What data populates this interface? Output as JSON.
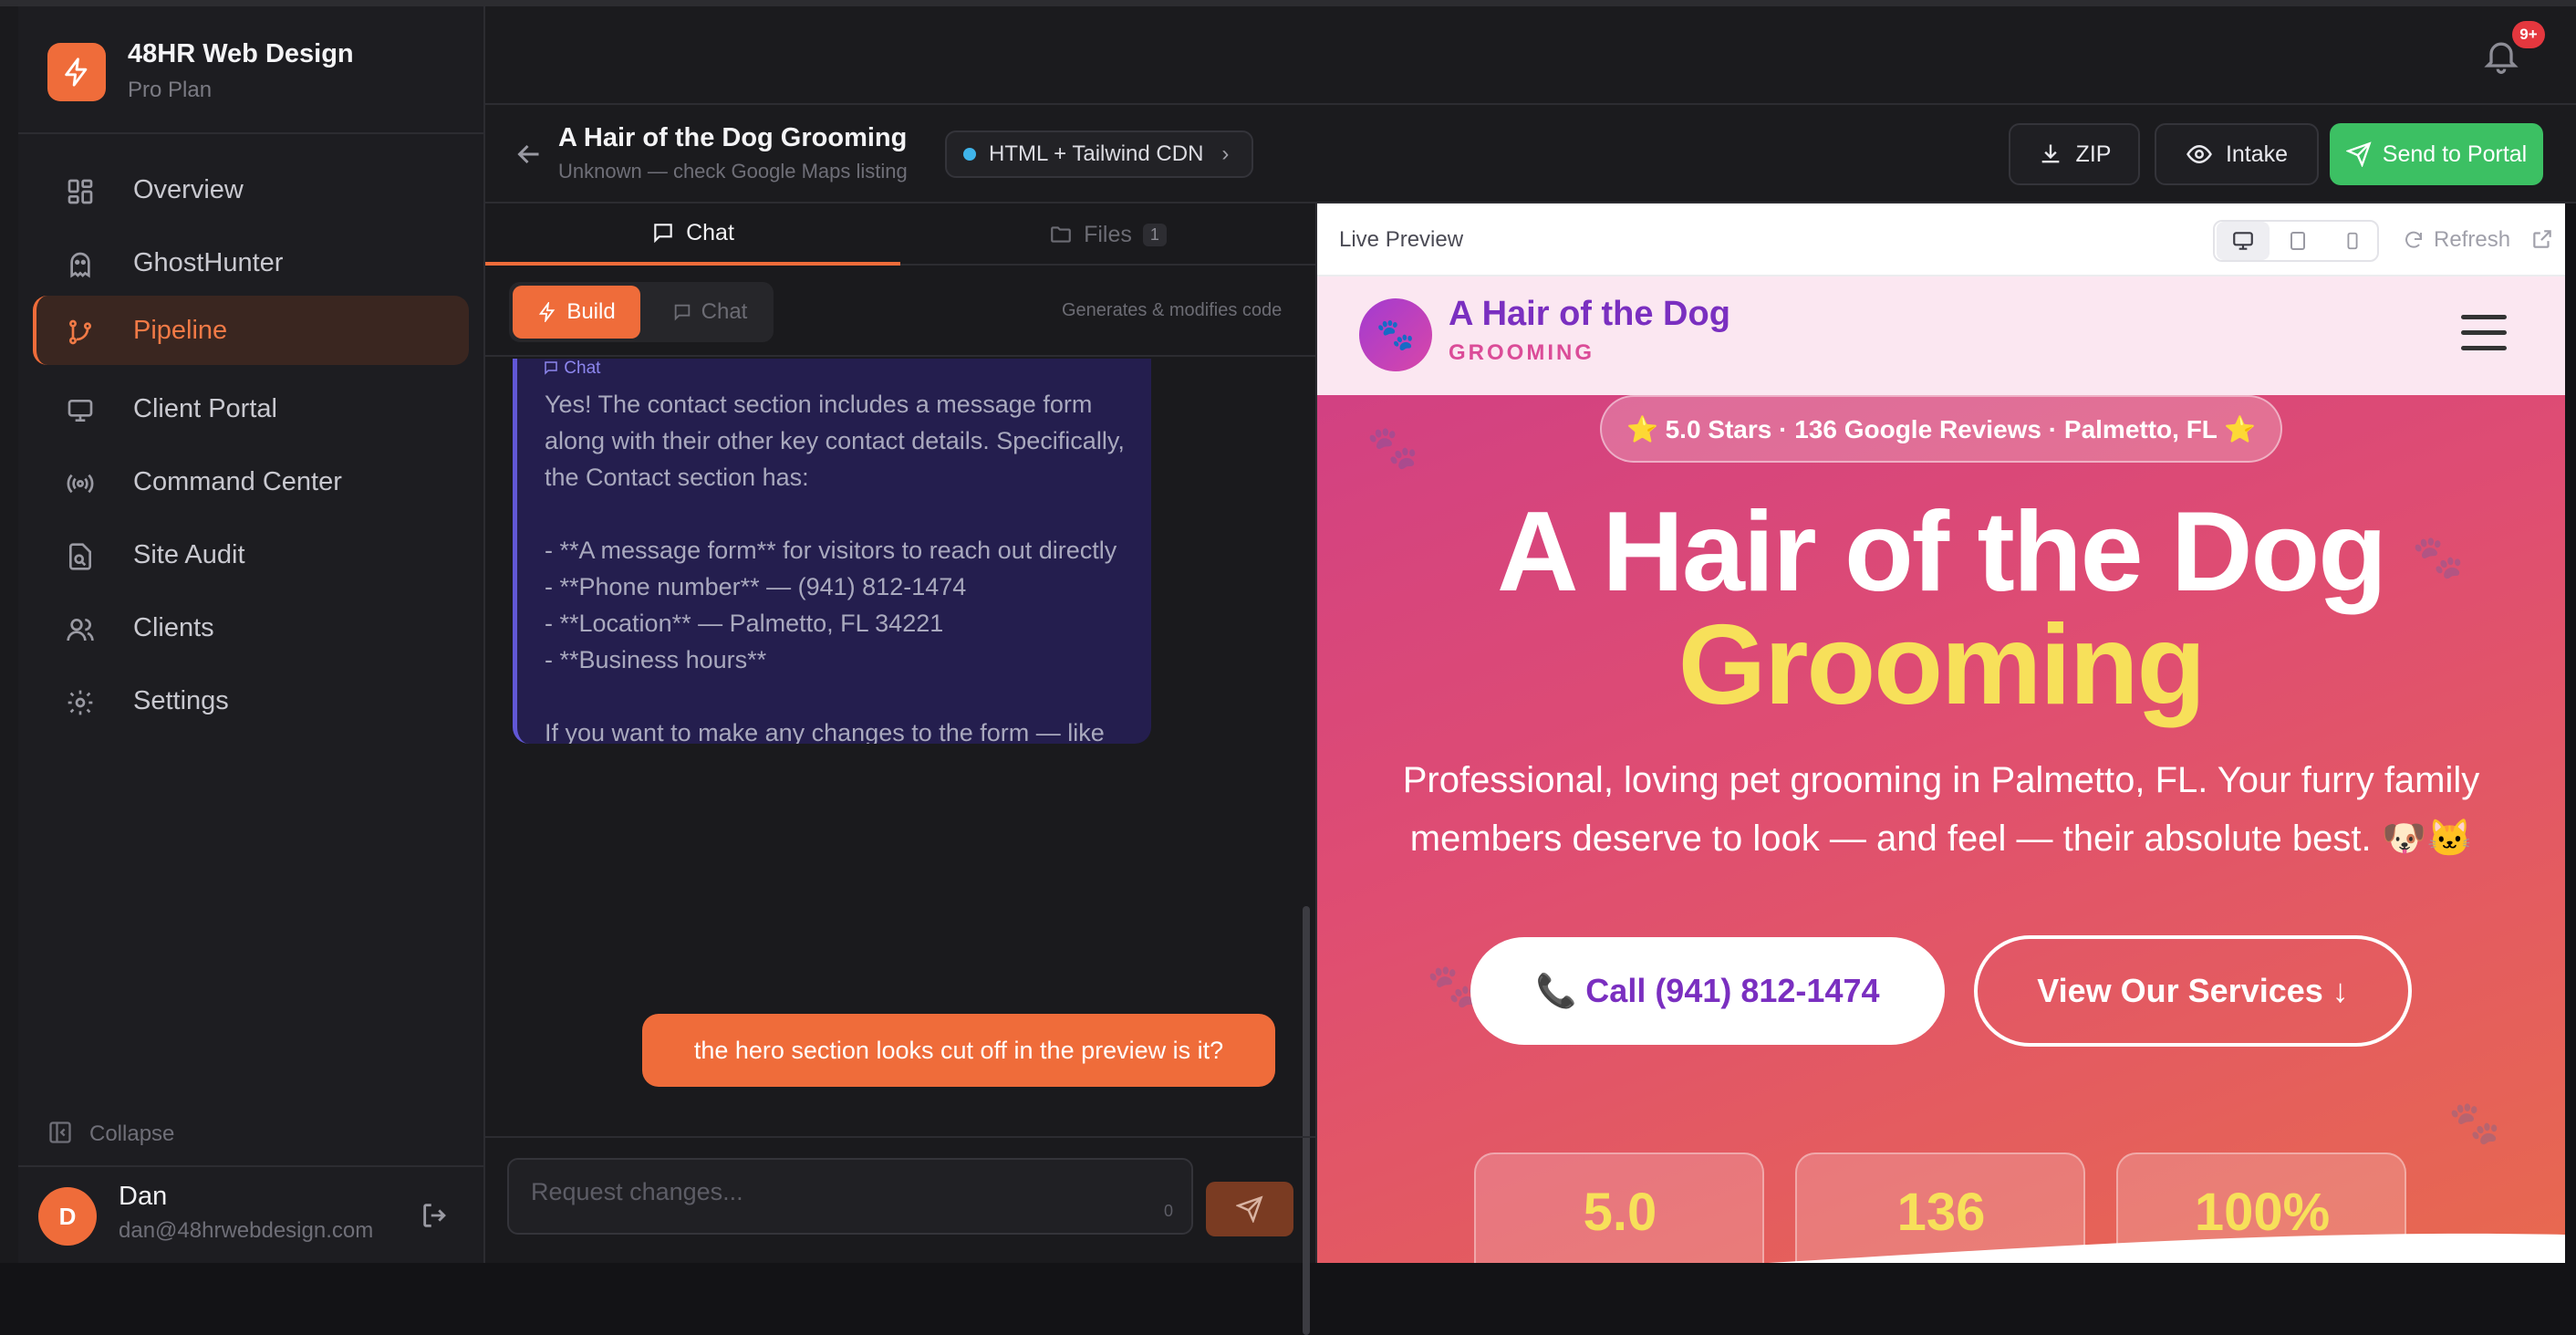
{
  "app": {
    "brand_name": "48HR Web Design",
    "plan": "Pro Plan",
    "accent": "#ef6c3a",
    "notifications_badge": "9+"
  },
  "sidebar": {
    "items": [
      {
        "label": "Overview",
        "icon": "grid-icon"
      },
      {
        "label": "GhostHunter",
        "icon": "ghost-icon"
      },
      {
        "label": "Pipeline",
        "icon": "branch-icon",
        "active": true
      },
      {
        "label": "Client Portal",
        "icon": "monitor-icon"
      },
      {
        "label": "Command Center",
        "icon": "broadcast-icon"
      },
      {
        "label": "Site Audit",
        "icon": "file-search-icon"
      },
      {
        "label": "Clients",
        "icon": "users-icon"
      },
      {
        "label": "Settings",
        "icon": "gear-icon"
      }
    ],
    "collapse_label": "Collapse",
    "user": {
      "initial": "D",
      "name": "Dan",
      "email": "dan@48hrwebdesign.com"
    }
  },
  "project": {
    "title": "A Hair of the Dog Grooming",
    "subtitle": "Unknown — check Google Maps listing",
    "stack": "HTML + Tailwind CDN",
    "zip_label": "ZIP",
    "intake_label": "Intake",
    "send_label": "Send to Portal"
  },
  "chat_panel": {
    "tabs": [
      {
        "label": "Chat",
        "active": true
      },
      {
        "label": "Files",
        "count": "1"
      }
    ],
    "mode_build": "Build",
    "mode_chat": "Chat",
    "mode_hint": "Generates & modifies code",
    "ai_tag": "Chat",
    "ai_message": "Yes! The contact section includes a message form along with their other key contact details. Specifically, the Contact section has:\n\n- **A message form** for visitors to reach out directly\n- **Phone number** — (941) 812-1474\n- **Location** — Palmetto, FL 34221\n- **Business hours**\n\nIf you want to make any changes to the form — like adding specific fields (pet name, breed, service type, preferred date), changing the layout, or connecting it to a real email submission service — just switch to **Build mode** and we can make those updates!",
    "user_message": "the hero section looks cut off in the preview is it?",
    "input_placeholder": "Request changes...",
    "char_count": "0"
  },
  "preview": {
    "title": "Live Preview",
    "refresh_label": "Refresh",
    "site": {
      "brand": "A Hair of the Dog",
      "brand_sub": "GROOMING",
      "logo_glyph": "🐾",
      "rating": "⭐ 5.0 Stars · 136 Google Reviews · Palmetto, FL ⭐",
      "hero_line1": "A Hair of the Dog",
      "hero_line2": "Grooming",
      "hero_sub": "Professional, loving pet grooming in Palmetto, FL. Your furry family members deserve to look — and feel — their absolute best. 🐶🐱",
      "cta_call": "📞 Call (941) 812-1474",
      "cta_services": "View Our Services ↓",
      "stats": [
        "5.0",
        "136",
        "100%"
      ]
    }
  }
}
